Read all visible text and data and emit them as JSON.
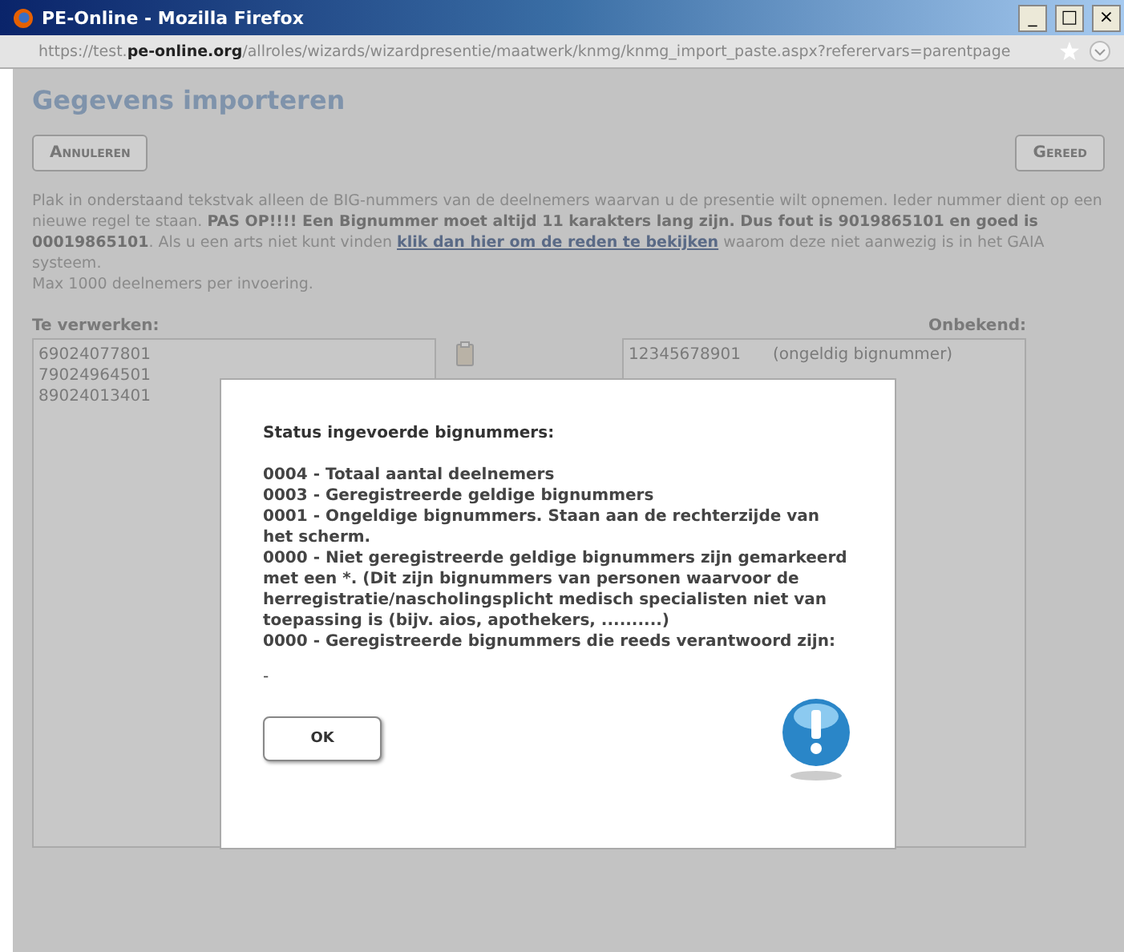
{
  "window": {
    "title": "PE-Online - Mozilla Firefox",
    "controls": [
      "_",
      "□",
      "×"
    ]
  },
  "address_bar": {
    "url": "https://test.**pe-online.org**/allroles/wizards/wizardpresentie/maatwerk/knmg/knmg_import_paste.aspx?referervars=parentpage"
  },
  "page": {
    "heading": "Gegevens importeren",
    "buttons": [
      {
        "label": "Annuleren"
      },
      {
        "label": "Gereed"
      }
    ],
    "instructions": "Plak in onderstaand tekstvak alleen de BIG-nummers van de deelnemers waarvan u de presentie wilt opnemen. Ieder nummer dient op een nieuwe regel te staan. **PAS OP!!!! Een Bignummer moet altijd 11 karakters lang zijn. Dus fout is 9019865101 en goed is 00019865101**. Als u een arts niet kunt vinden ",
    "link": "klik dan hier om de reden te bekijken",
    "instructions_end": " waarom deze niet aanwezig is in het GAIA systeem.",
    "limit": "Max 1000 deelnemers per invoering.",
    "to_process": {
      "label": "Te verwerken:",
      "lines": [
        "69024077801",
        "79024964501",
        "89024013401"
      ]
    },
    "unknown": {
      "label": "Onbekend:",
      "rows": [
        {
          "number": "12345678901",
          "reason": "(ongeldig bignummer)"
        }
      ]
    }
  },
  "dialog": {
    "title": "Status ingevoerde bignummers:",
    "lines": [
      "0004 - Totaal aantal deelnemers",
      "0003 - Geregistreerde geldige bignummers",
      "0001 - Ongeldige bignummers. Staan aan de rechterzijde van het scherm.",
      "0000 - Niet geregistreerde geldige bignummers zijn gemarkeerd met een *. (Dit zijn bignummers van personen waarvoor de herregistratie/nascholingsplicht medisch specialisten niet van toepassing is (bijv. aios, apothekers, ..........)",
      "0000 - Geregistreerde bignummers die reeds verantwoord zijn:"
    ],
    "footer": "-",
    "button": "OK"
  }
}
